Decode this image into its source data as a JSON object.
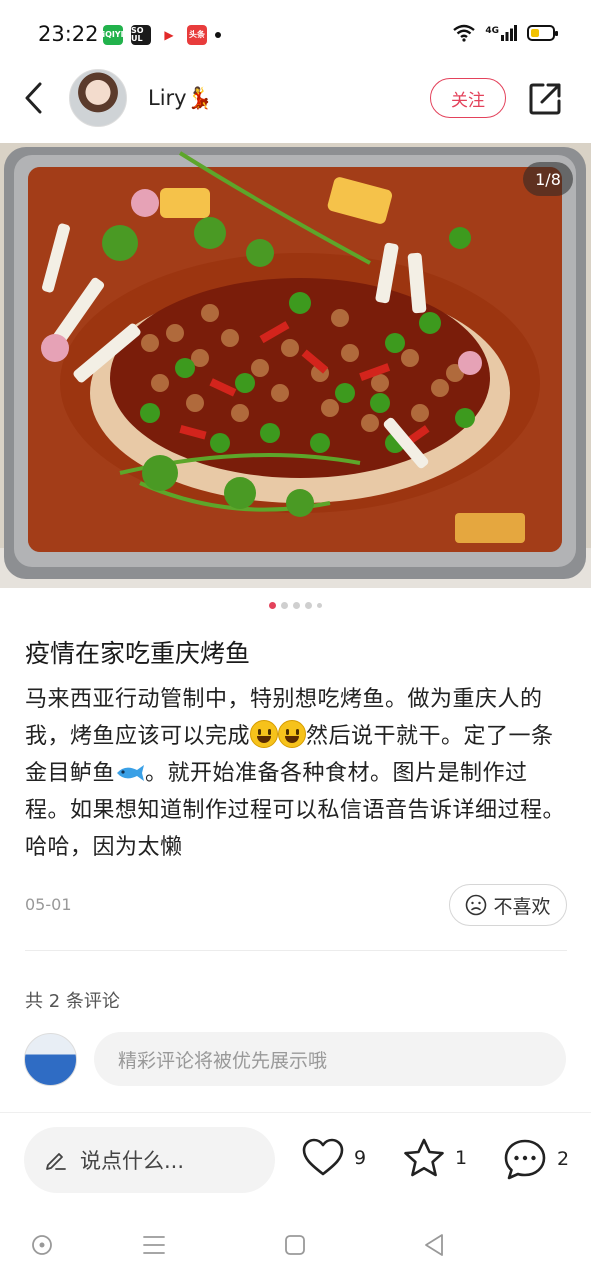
{
  "status_bar": {
    "time": "23:22",
    "apps": [
      {
        "name": "iqiyi-icon",
        "label": "iQIYI",
        "color": "#22b24c"
      },
      {
        "name": "soul-icon",
        "label": "SO UL",
        "color": "#1a1a1a"
      },
      {
        "name": "video-icon",
        "label": "▶",
        "color": "#e22a2a"
      },
      {
        "name": "toutiao-icon",
        "label": "头条",
        "color": "#e83c3c"
      }
    ],
    "network": "4G",
    "battery_level": 0.4
  },
  "header": {
    "username": "Liry💃",
    "follow_label": "关注"
  },
  "photo": {
    "counter": "1/8",
    "pages": 5,
    "active_page": 1
  },
  "post": {
    "title": "疫情在家吃重庆烤鱼",
    "body_part1": "马来西亚行动管制中，特别想吃烤鱼。做为重庆人的我，烤鱼应该可以完成",
    "body_part2": "然后说干就干。定了一条金目鲈鱼",
    "body_part3": "。就开始准备各种食材。图片是制作过程。如果想知道制作过程可以私信语音告诉详细过程。哈哈，因为太懒",
    "date": "05-01",
    "dislike_label": "不喜欢"
  },
  "comments": {
    "count_label": "共 2 条评论",
    "input_placeholder": "精彩评论将被优先展示哦"
  },
  "bottom_bar": {
    "say_placeholder": "说点什么...",
    "likes": "9",
    "favorites": "1",
    "comments": "2"
  },
  "colors": {
    "accent": "#e3425b",
    "muted_text": "#999999"
  }
}
